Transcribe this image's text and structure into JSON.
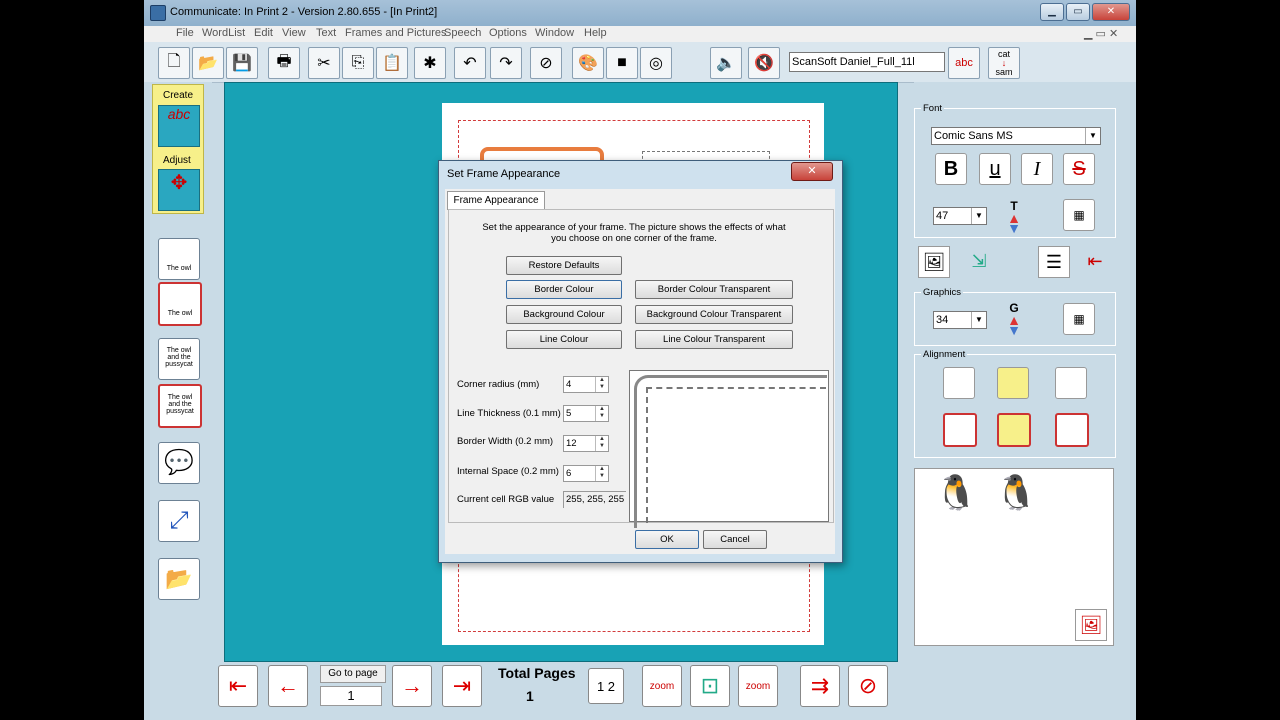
{
  "window": {
    "title": "Communicate: In Print 2 - Version 2.80.655 - [In Print2]"
  },
  "menu": [
    "File",
    "WordList",
    "Edit",
    "View",
    "Text",
    "Frames and Pictures",
    "Speech",
    "Options",
    "Window",
    "Help"
  ],
  "voice": {
    "selected": "ScanSoft Daniel_Full_11l"
  },
  "toolbar_extra": {
    "abc_label": "abc",
    "cat_label": "cat",
    "sam_label": "sam"
  },
  "leftbar": {
    "create_label": "Create",
    "adjust_label": "Adjust",
    "abc_label": "abc",
    "cells": [
      "The owl",
      "The owl",
      "The owl and the pussycat",
      "The owl and the pussycat"
    ]
  },
  "dialog": {
    "title": "Set Frame Appearance",
    "close": "✕",
    "tab": "Frame Appearance",
    "description": "Set the appearance of your frame. The picture shows the effects of what you choose on one corner of the frame.",
    "buttons": {
      "restore": "Restore Defaults",
      "border_colour": "Border Colour",
      "border_transparent": "Border Colour Transparent",
      "background_colour": "Background Colour",
      "background_transparent": "Background Colour Transparent",
      "line_colour": "Line Colour",
      "line_transparent": "Line Colour Transparent",
      "ok": "OK",
      "cancel": "Cancel"
    },
    "fields": {
      "corner_radius_label": "Corner radius (mm)",
      "corner_radius_value": "4",
      "line_thickness_label": "Line Thickness (0.1 mm)",
      "line_thickness_value": "5",
      "border_width_label": "Border Width (0.2 mm)",
      "border_width_value": "12",
      "internal_space_label": "Internal Space (0.2 mm)",
      "internal_space_value": "6",
      "rgb_label": "Current cell RGB value",
      "rgb_value": "255, 255, 255"
    }
  },
  "right": {
    "font_label": "Font",
    "font_name": "Comic Sans MS",
    "bold": "B",
    "underline": "u",
    "italic": "I",
    "strike": "S",
    "font_size": "47",
    "graphics_label": "Graphics",
    "graphics_size": "34",
    "alignment_label": "Alignment",
    "t_letter": "T",
    "g_letter": "G"
  },
  "bottom": {
    "goto_label": "Go to page",
    "page_value": "1",
    "total_pages_label": "Total Pages",
    "total_pages_value": "1",
    "two_pages": "1 2",
    "zoom_label": "zoom"
  }
}
